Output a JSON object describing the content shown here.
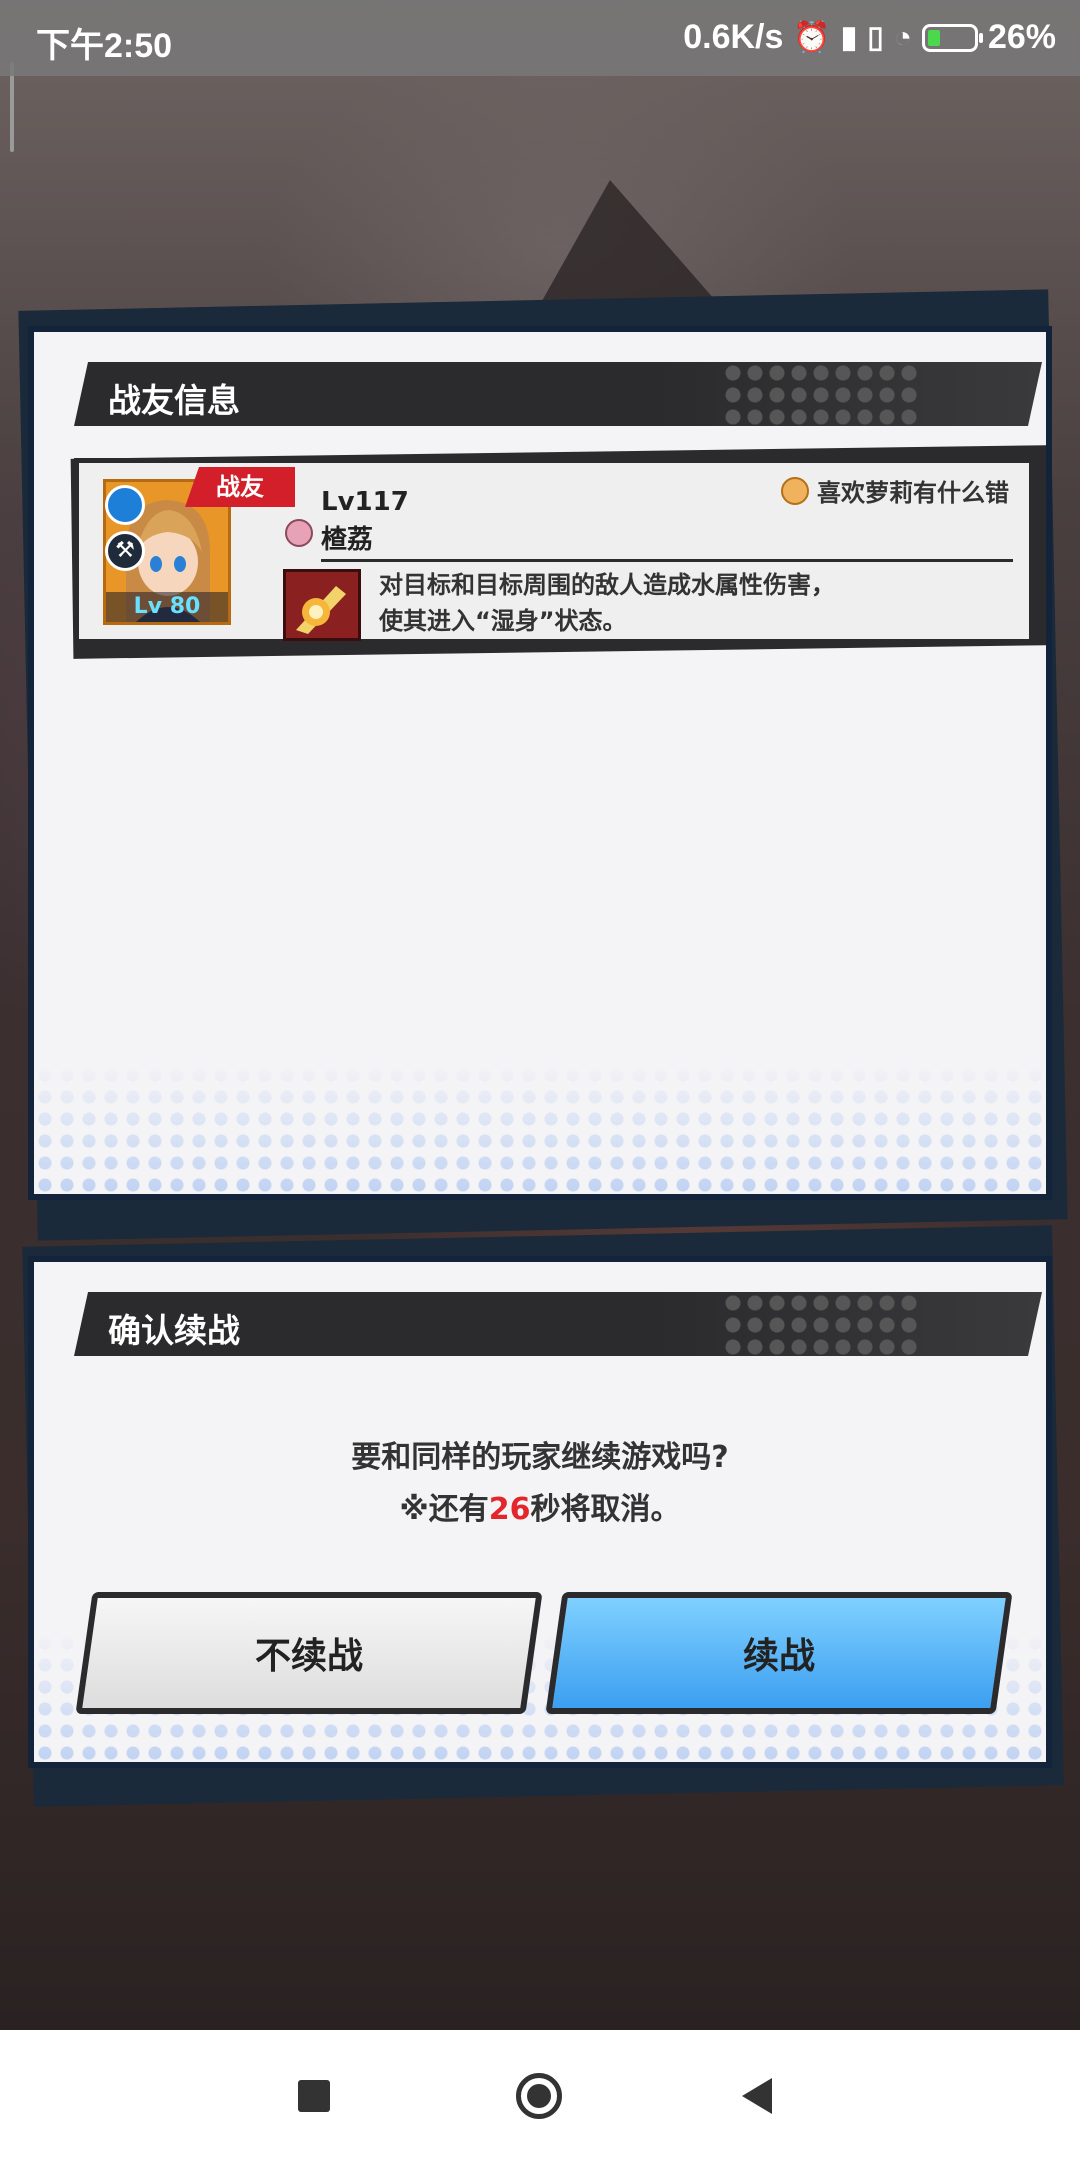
{
  "status_bar": {
    "time": "下午2:50",
    "network_speed": "0.6K/s",
    "battery": "26%",
    "icons": [
      "alarm-icon",
      "signal-icon",
      "volte-icon",
      "signal-2-icon",
      "wifi-icon",
      "battery-charging-icon"
    ]
  },
  "friend_panel": {
    "title": "战友信息",
    "friend": {
      "tag": "战友",
      "unit_level": "Lv 80",
      "player_level": "Lv117",
      "player_name": "楂荔",
      "title_badge": "喜欢萝莉有什么错",
      "skill_description_line1": "对目标和目标周围的敌人造成水属性伤害，",
      "skill_description_line2": "使其进入“湿身”状态。"
    }
  },
  "confirm_panel": {
    "title": "确认续战",
    "question": "要和同样的玩家继续游戏吗?",
    "countdown_prefix": "※还有",
    "countdown_seconds": "26",
    "countdown_suffix": "秒将取消。",
    "decline_label": "不续战",
    "accept_label": "续战"
  },
  "colors": {
    "panel_border": "#13243a",
    "header_bg": "#2b2b2d",
    "friend_tag": "#d21f2a",
    "accept_button": "#3c9ff0",
    "countdown_number": "#e2262c"
  }
}
